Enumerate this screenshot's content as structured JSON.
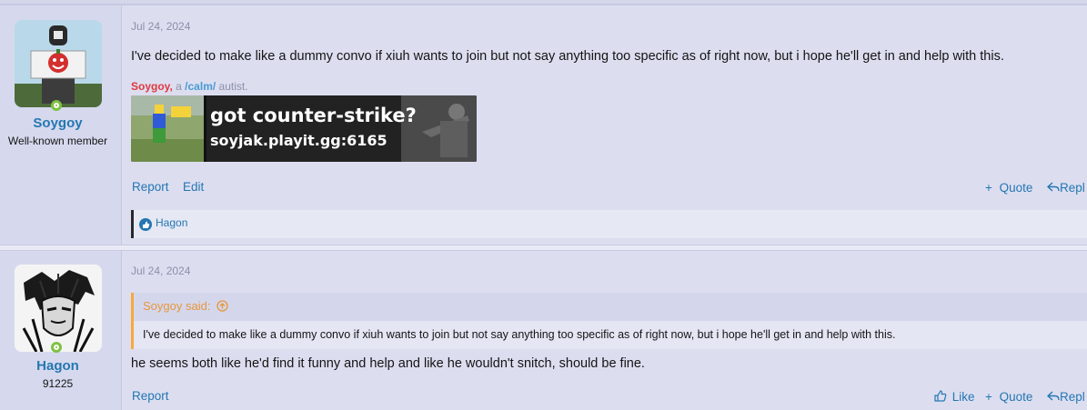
{
  "posts": [
    {
      "user": {
        "name": "Soygoy",
        "title": "Well-known member"
      },
      "date": "Jul 24, 2024",
      "message": "I've decided to make like a dummy convo if xiuh wants to join but not say anything too specific as of right now, but i hope he'll get in and help with this.",
      "signature": {
        "name": "Soygoy,",
        "a": "a",
        "board": "/calm/",
        "suffix": "autist.",
        "banner_line1": "got counter-strike?",
        "banner_line2": "soyjak.playit.gg:6165"
      },
      "actions": {
        "report": "Report",
        "edit": "Edit",
        "quote": "Quote",
        "reply": "Repl"
      },
      "reactions": {
        "users": "Hagon"
      }
    },
    {
      "user": {
        "name": "Hagon",
        "title": "91225"
      },
      "date": "Jul 24, 2024",
      "quote": {
        "author": "Soygoy said:",
        "text": "I've decided to make like a dummy convo if xiuh wants to join but not say anything too specific as of right now, but i hope he'll get in and help with this."
      },
      "message": "he seems both like he'd find it funny and help and like he wouldn't snitch, should be fine.",
      "actions": {
        "report": "Report",
        "like": "Like",
        "quote": "Quote",
        "reply": "Repl"
      }
    }
  ],
  "colors": {
    "accent": "#2577b1",
    "online": "#7fc142",
    "quote_border": "#f5a93c",
    "sig_name": "#e0393f"
  }
}
